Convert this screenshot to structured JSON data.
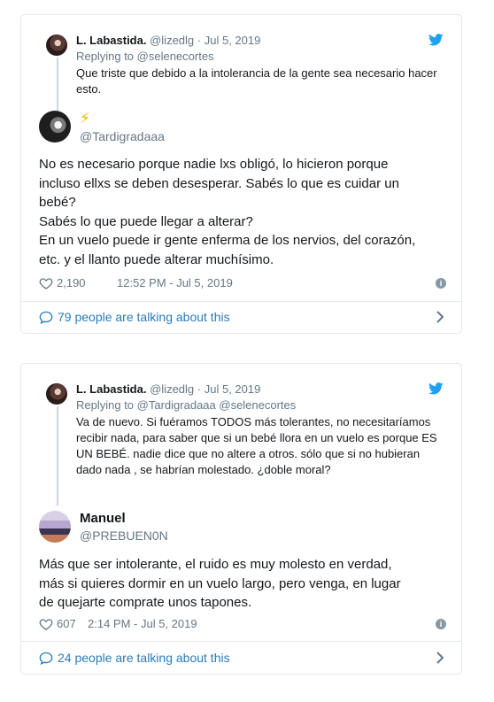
{
  "tweets": [
    {
      "parent": {
        "name": "L. Labastida.",
        "handle": "@lizedlg",
        "dot": "·",
        "date": "Jul 5, 2019",
        "replying_label": "Replying to",
        "replying_to": "@selenecortes",
        "text": "Que triste que debido a  la intolerancia de la gente sea necesario hacer esto."
      },
      "main": {
        "name_emoji": "⚡",
        "handle": "@Tardigradaaa",
        "text_lines": [
          "No es necesario porque nadie lxs obligó, lo hicieron porque",
          "incluso ellxs se deben desesperar. Sabés lo que es cuidar un",
          "bebé?",
          "Sabés lo que puede llegar a alterar?",
          "En un vuelo puede ir gente enferma de los nervios, del corazón,",
          "etc. y el llanto puede alterar muchísimo."
        ],
        "likes": "2,190",
        "timestamp": "12:52 PM - Jul 5, 2019"
      },
      "talking": "79 people are talking about this"
    },
    {
      "parent": {
        "name": "L. Labastida.",
        "handle": "@lizedlg",
        "dot": "·",
        "date": "Jul 5, 2019",
        "replying_label": "Replying to",
        "replying_to": "@Tardigradaaa @selenecortes",
        "text": "Va de nuevo. Si fuéramos TODOS más tolerantes, no necesitaríamos recibir nada, para saber que si un bebé llora en un vuelo es porque ES UN BEBÉ. nadie dice que no altere a otros. sólo que si no hubieran dado nada , se habrían molestado. ¿doble moral?"
      },
      "main": {
        "name": "Manuel",
        "handle": "@PREBUEN0N",
        "text_lines": [
          "Más que ser intolerante, el ruido es muy molesto en verdad,",
          "más si quieres dormir en un vuelo largo, pero venga, en lugar",
          "de quejarte comprate unos tapones."
        ],
        "likes": "607",
        "timestamp": "2:14 PM - Jul 5, 2019"
      },
      "talking": "24 people are talking about this"
    }
  ],
  "icons": {
    "bird": "twitter-bird-icon",
    "heart": "heart-icon",
    "info": "info-icon",
    "talk": "speech-bubble-icon",
    "chevron": "chevron-right-icon"
  },
  "colors": {
    "brand": "#1da1f2",
    "link": "#2b7bb9",
    "muted": "#657786",
    "border": "#e1e8ed",
    "bolt": "#f5b800"
  }
}
